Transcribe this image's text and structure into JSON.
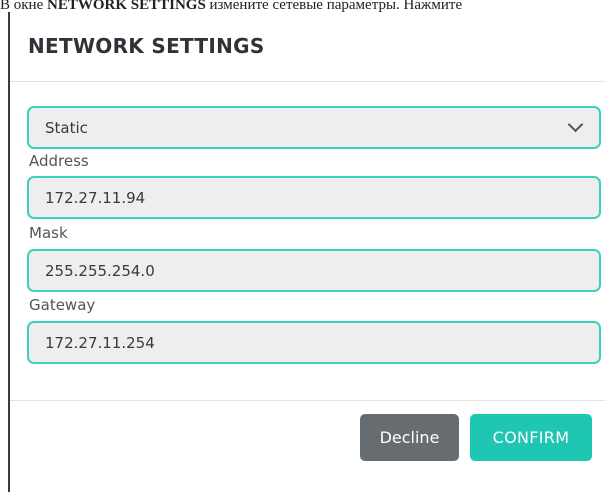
{
  "caption": {
    "prefix": "В окне",
    "bold": "NETWORK SETTINGS",
    "suffix": "измените сетевые параметры. Нажмите"
  },
  "dialog": {
    "title": "NETWORK SETTINGS",
    "mode": {
      "selected": "Static",
      "icon": "chevron-down-icon"
    },
    "fields": {
      "address": {
        "label": "Address",
        "value": "172.27.11.94"
      },
      "mask": {
        "label": "Mask",
        "value": "255.255.254.0"
      },
      "gateway": {
        "label": "Gateway",
        "value": "172.27.11.254"
      }
    },
    "buttons": {
      "decline": "Decline",
      "confirm": "CONFIRM"
    }
  },
  "colors": {
    "accent": "#1fc6b1",
    "field_border": "#3fd0bd",
    "field_bg": "#eeeeee",
    "decline_bg": "#666c70",
    "title_text": "#2e3338"
  }
}
